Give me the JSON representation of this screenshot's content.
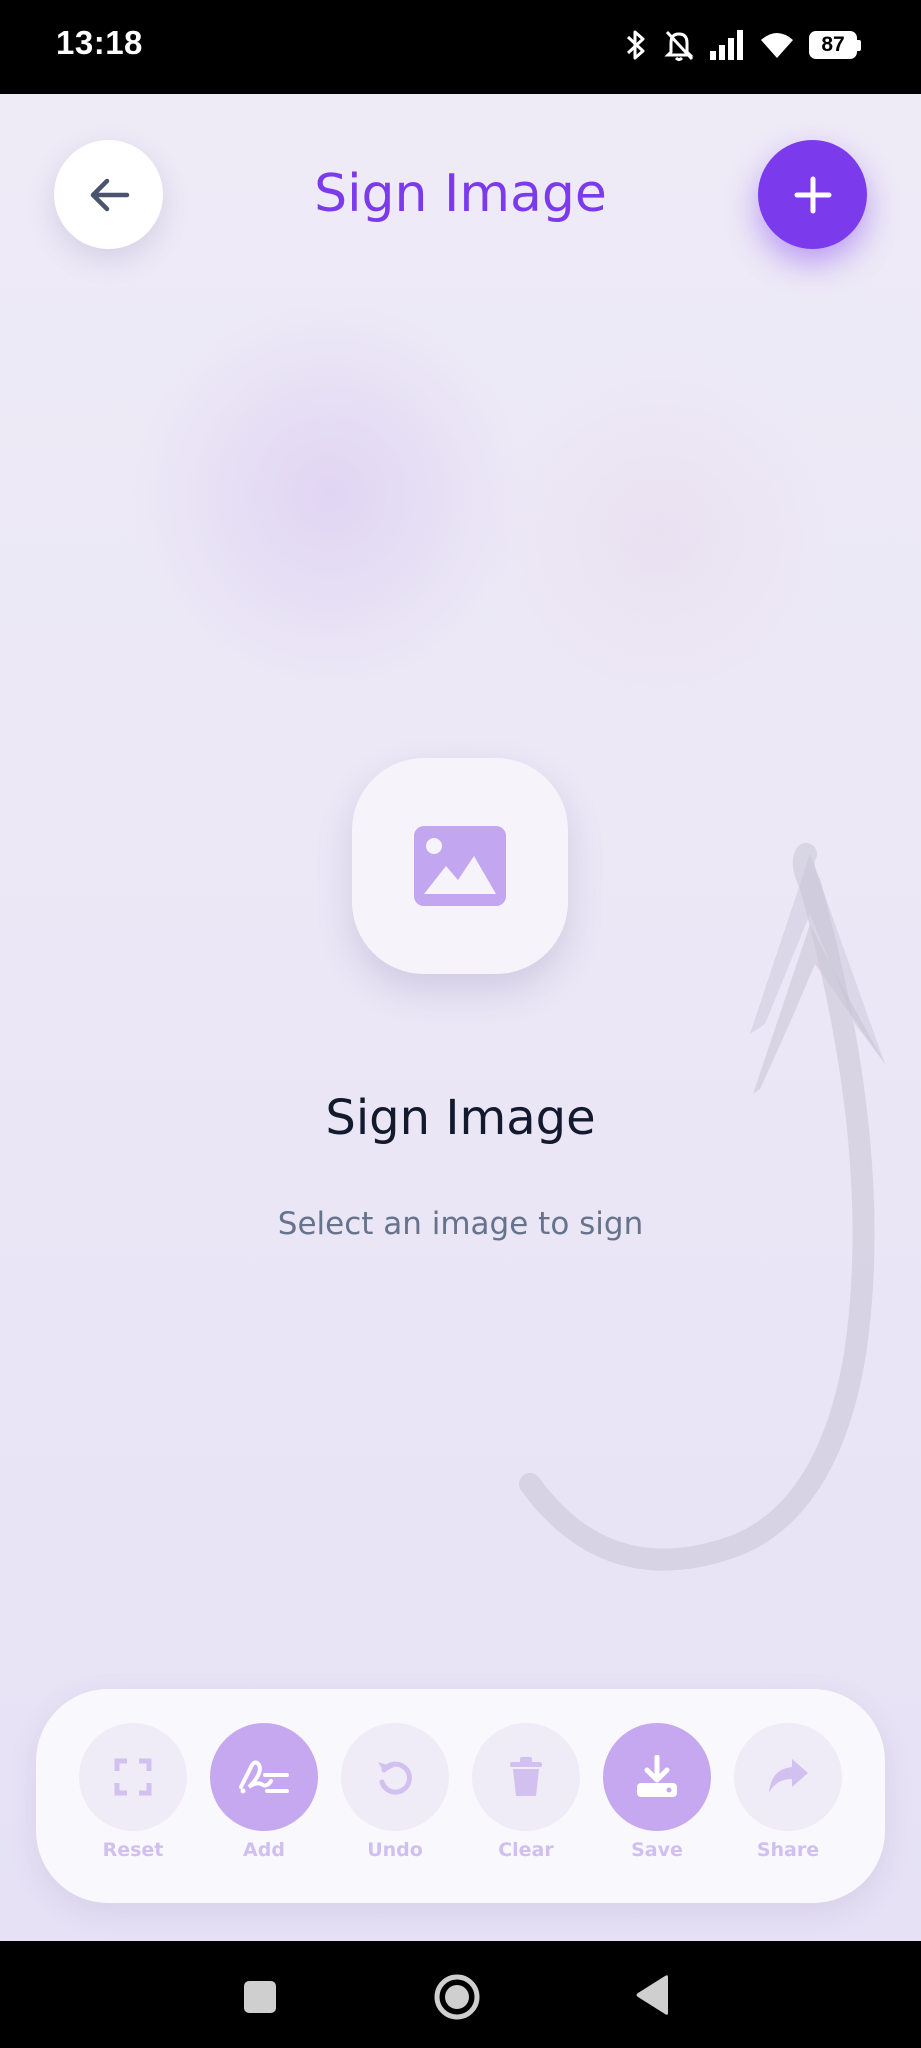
{
  "status_bar": {
    "time": "13:18",
    "battery": "87",
    "icons": [
      "bluetooth-icon",
      "bell-off-icon",
      "signal-icon",
      "wifi-icon",
      "battery-icon"
    ]
  },
  "header": {
    "title": "Sign Image",
    "back_icon": "arrow-left-icon",
    "add_icon": "plus-icon"
  },
  "empty_state": {
    "icon": "image-icon",
    "title": "Sign Image",
    "subtitle": "Select an image to sign"
  },
  "toolbar": {
    "items": [
      {
        "label": "Reset",
        "icon": "fullscreen-icon",
        "active": false
      },
      {
        "label": "Add",
        "icon": "signature-icon",
        "active": true
      },
      {
        "label": "Undo",
        "icon": "undo-icon",
        "active": false
      },
      {
        "label": "Clear",
        "icon": "trash-icon",
        "active": false
      },
      {
        "label": "Save",
        "icon": "download-icon",
        "active": true
      },
      {
        "label": "Share",
        "icon": "share-icon",
        "active": false
      }
    ]
  },
  "colors": {
    "accent": "#7c3aed",
    "accent_light": "#c6a8f1",
    "title_dark": "#141a2e",
    "subtitle": "#66738c"
  }
}
